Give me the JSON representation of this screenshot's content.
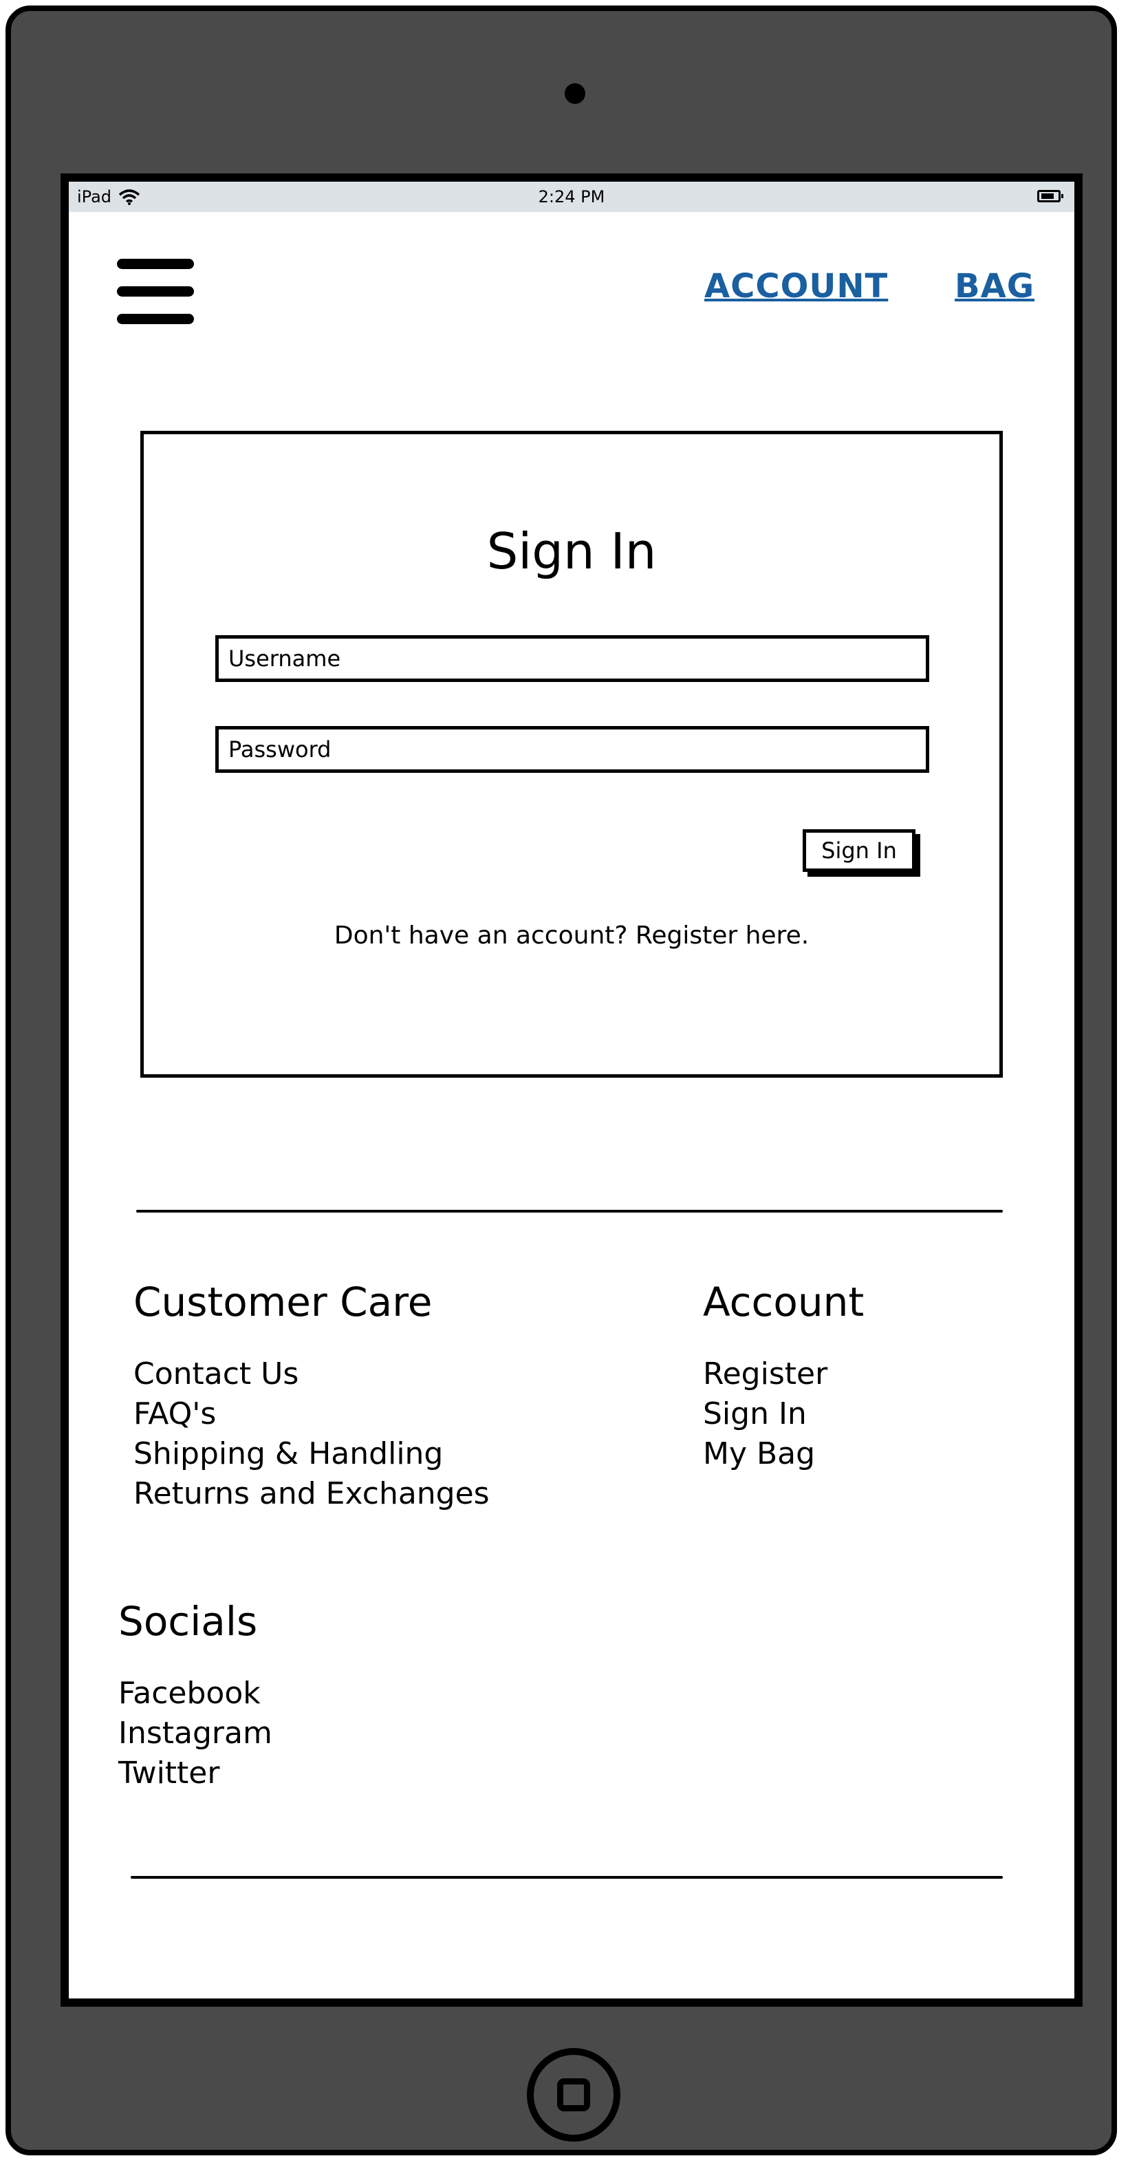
{
  "status_bar": {
    "carrier": "iPad",
    "time": "2:24 PM",
    "wifi_icon": "wifi-icon",
    "battery_icon": "battery-icon"
  },
  "header": {
    "menu_icon": "hamburger-menu-icon",
    "account_link": "ACCOUNT",
    "bag_link": "BAG",
    "link_color": "#1a5fa0"
  },
  "signin": {
    "title": "Sign In",
    "username_placeholder": "Username",
    "password_placeholder": "Password",
    "button_label": "Sign In",
    "register_text": "Don't have an account? Register here."
  },
  "footer": {
    "customer_care": {
      "heading": "Customer Care",
      "links": [
        "Contact Us",
        "FAQ's",
        "Shipping & Handling",
        "Returns and Exchanges"
      ]
    },
    "account": {
      "heading": "Account",
      "links": [
        "Register",
        "Sign In",
        "My Bag"
      ]
    },
    "socials": {
      "heading": "Socials",
      "links": [
        "Facebook",
        "Instagram",
        "Twitter"
      ]
    }
  },
  "device": {
    "frame_color": "#4a4a4a",
    "statusbar_color": "#dde2e6"
  }
}
